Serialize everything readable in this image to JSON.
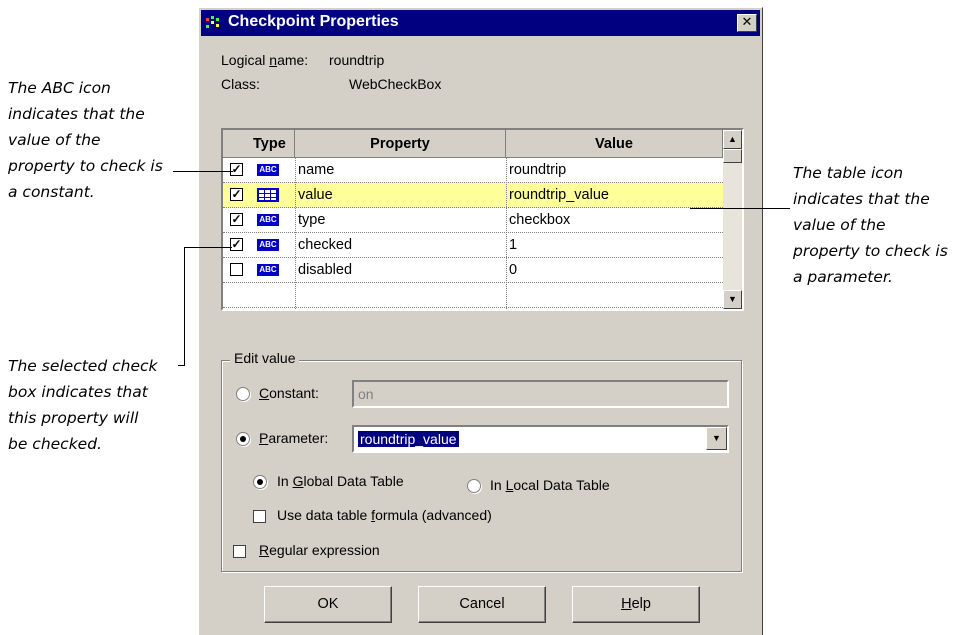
{
  "callouts": {
    "left_top": [
      "The ABC icon",
      "indicates that the",
      "value of the",
      "property to check is",
      "a constant."
    ],
    "right": [
      "The table icon",
      "indicates that the",
      "value of the",
      "property to check is",
      "a parameter."
    ],
    "left_bottom": [
      "The selected check",
      "box indicates that",
      "this property will",
      "be checked."
    ]
  },
  "dialog": {
    "title": "Checkpoint Properties",
    "close_glyph": "✕",
    "logical_name_label_pre": "Logical ",
    "logical_name_label_u": "n",
    "logical_name_label_post": "ame:",
    "logical_name_value": "roundtrip",
    "class_label": "Class:",
    "class_value": "WebCheckBox"
  },
  "grid": {
    "columns": [
      "Type",
      "Property",
      "Value"
    ],
    "rows": [
      {
        "checked": true,
        "icon": "abc-icon",
        "property": "name",
        "value": "roundtrip",
        "highlighted": false
      },
      {
        "checked": true,
        "icon": "table-icon",
        "property": "value",
        "value": "roundtrip_value",
        "highlighted": true
      },
      {
        "checked": true,
        "icon": "abc-icon",
        "property": "type",
        "value": "checkbox",
        "highlighted": false
      },
      {
        "checked": true,
        "icon": "abc-icon",
        "property": "checked",
        "value": "1",
        "highlighted": false
      },
      {
        "checked": false,
        "icon": "abc-icon",
        "property": "disabled",
        "value": "0",
        "highlighted": false
      }
    ],
    "abc_text": "ABC",
    "check_glyph": "✓"
  },
  "edit_value": {
    "group_label": "Edit value",
    "constant_u": "C",
    "constant_rest": "onstant:",
    "constant_value": "on",
    "constant_selected": false,
    "parameter_u": "P",
    "parameter_rest": "arameter:",
    "parameter_value": "roundtrip_value",
    "parameter_selected": true,
    "global_pre": "In ",
    "global_u": "G",
    "global_post": "lobal Data Table",
    "global_selected": true,
    "local_pre": "In ",
    "local_u": "L",
    "local_post": "ocal Data Table",
    "local_selected": false,
    "formula_pre": "Use data table ",
    "formula_u": "f",
    "formula_post": "ormula (advanced)",
    "formula_checked": false,
    "regex_u": "R",
    "regex_rest": "egular expression",
    "regex_checked": false
  },
  "buttons": {
    "ok": "OK",
    "cancel": "Cancel",
    "help_u": "H",
    "help_rest": "elp"
  },
  "colors": {
    "titlebar": "#000080",
    "dialog_bg": "#d4d0c8",
    "highlight_row": "#ffff99",
    "icon_blue": "#0000c8"
  }
}
